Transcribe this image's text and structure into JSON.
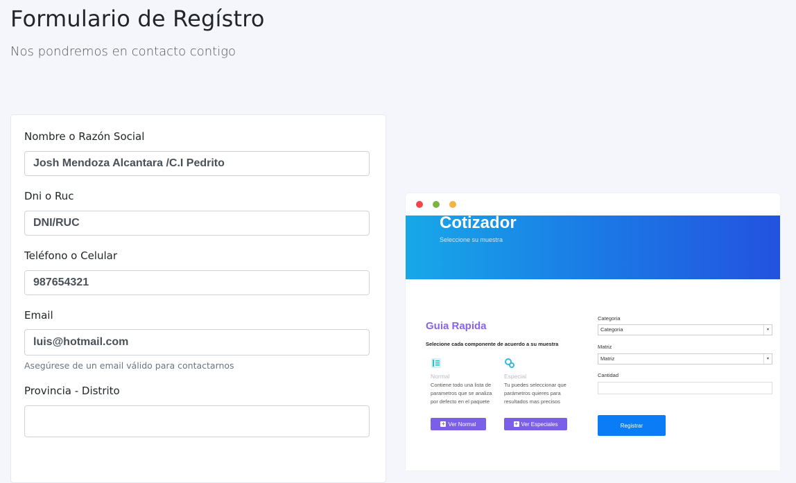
{
  "header": {
    "title": "Formulario de Regístro",
    "subtitle": "Nos pondremos en contacto contigo"
  },
  "form": {
    "name": {
      "label": "Nombre o Razón Social",
      "value": "Josh Mendoza Alcantara /C.I Pedrito"
    },
    "dni": {
      "label": "Dni o Ruc",
      "value": "DNI/RUC"
    },
    "phone": {
      "label": "Teléfono o Celular",
      "value": "987654321"
    },
    "email": {
      "label": "Email",
      "value": "luis@hotmail.com",
      "help": "Asegúrese de un email válido para contactarnos"
    },
    "province": {
      "label": "Provincia - Distrito",
      "value": ""
    }
  },
  "preview": {
    "window_dots": [
      "#f2474a",
      "#7cb342",
      "#f5b342"
    ],
    "banner_title": "Cotizador",
    "banner_subtitle": "Seleccione su muestra",
    "guide_title": "Guia Rapida",
    "guide_desc": "Selecione cada componente de acuerdo a su muestra",
    "options": [
      {
        "icon": "list-icon",
        "title": "Normal",
        "text": "Contiene todo una lista de parametros que se analiza por defecto en el paquete",
        "button": "Ver Normal"
      },
      {
        "icon": "gears-icon",
        "title": "Especial",
        "text": "Tu puedes seleccionar que parámetros quieres para resultados mas precisos",
        "button": "Ver Especiales"
      }
    ],
    "category_label": "Categoria",
    "category_value": "Categoria",
    "matrix_label": "Matriz",
    "matrix_value": "Matriz",
    "quantity_label": "Cantidad",
    "submit_label": "Registrar"
  }
}
